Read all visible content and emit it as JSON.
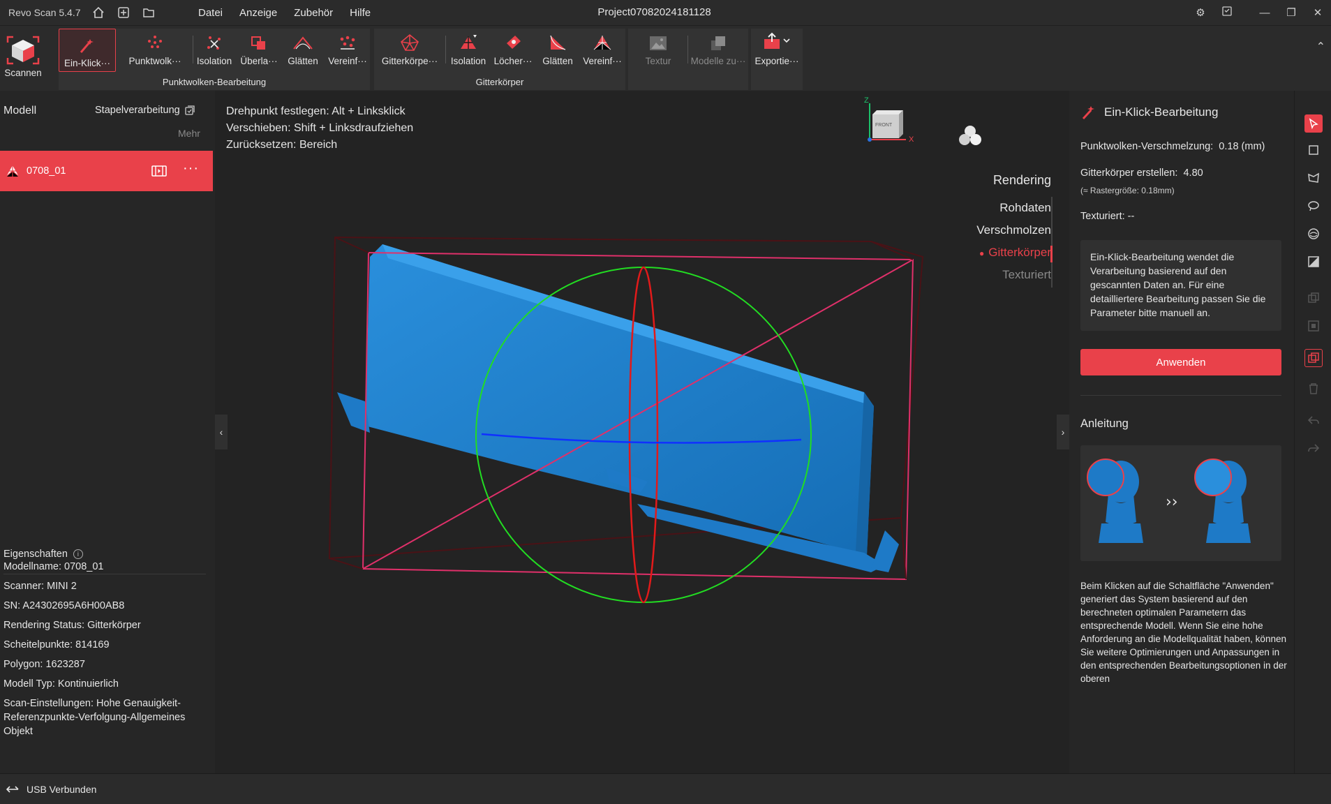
{
  "titlebar": {
    "app_name": "Revo Scan 5.4.7",
    "menu": [
      "Datei",
      "Anzeige",
      "Zubehör",
      "Hilfe"
    ],
    "project": "Project07082024181128"
  },
  "toolbar": {
    "scan": "Scannen",
    "pc_group": "Punktwolken-Bearbeitung",
    "mesh_group": "Gitterkörper",
    "buttons": {
      "one_click": "Ein-Klick···",
      "pointcloud": "Punktwolk···",
      "isolation1": "Isolation",
      "overlap": "Überla···",
      "smooth1": "Glätten",
      "simplify1": "Vereinf···",
      "mesh": "Gitterkörpe···",
      "isolation2": "Isolation",
      "holes": "Löcher···",
      "smooth2": "Glätten",
      "simplify2": "Vereinf···",
      "texture": "Textur",
      "merge": "Modelle zu···",
      "export": "Exportie···"
    }
  },
  "left": {
    "model_title": "Modell",
    "batch": "Stapelverarbeitung",
    "more": "Mehr",
    "model_name": "0708_01",
    "props_title": "Eigenschaften",
    "props": [
      "Modellname:  0708_01",
      "Scanner:  MINI 2",
      "SN:  A24302695A6H00AB8",
      "Rendering Status:  Gitterkörper",
      "Scheitelpunkte:  814169",
      "Polygon:  1623287",
      "Modell Typ:  Kontinuierlich"
    ],
    "scan_settings": "Scan-Einstellungen:  Hohe Genauigkeit-Referenzpunkte-Verfolgung-Allgemeines Objekt"
  },
  "viewport": {
    "hint1_label": "Drehpunkt festlegen:",
    "hint1_key": "Alt + Linksklick",
    "hint2_label": "Verschieben:",
    "hint2_key": "Shift + Linksdraufziehen",
    "hint3_label": "Zurücksetzen:",
    "hint3_key": "Bereich",
    "rendering_title": "Rendering",
    "rendering_opts": [
      "Rohdaten",
      "Verschmolzen",
      "Gitterkörper",
      "Texturiert"
    ],
    "active_option": "Gitterkörper",
    "cube_label": "FRONT",
    "axis_z": "Z",
    "axis_x": "X"
  },
  "right": {
    "title": "Ein-Klick-Bearbeitung",
    "fusion_label": "Punktwolken-Verschmelzung:",
    "fusion_value": "0.18 (mm)",
    "mesh_label": "Gitterkörper erstellen:",
    "mesh_value": "4.80",
    "grid_note": "(≈ Rastergröße: 0.18mm)",
    "textured": "Texturiert: --",
    "description": "Ein-Klick-Bearbeitung wendet die Verarbeitung basierend auf den gescannten Daten an. Für eine detailliertere Bearbeitung passen Sie die Parameter bitte manuell an.",
    "apply": "Anwenden",
    "guide_title": "Anleitung",
    "guide_text": "Beim Klicken auf die Schaltfläche \"Anwenden\" generiert das System basierend auf den berechneten optimalen Parametern das entsprechende Modell. Wenn Sie eine hohe Anforderung an die Modellqualität haben, können Sie weitere Optimierungen und Anpassungen in den entsprechenden Bearbeitungsoptionen in der oberen"
  },
  "status": {
    "usb": "USB Verbunden"
  },
  "colors": {
    "accent": "#e9414a",
    "mesh": "#1e7ac7"
  }
}
